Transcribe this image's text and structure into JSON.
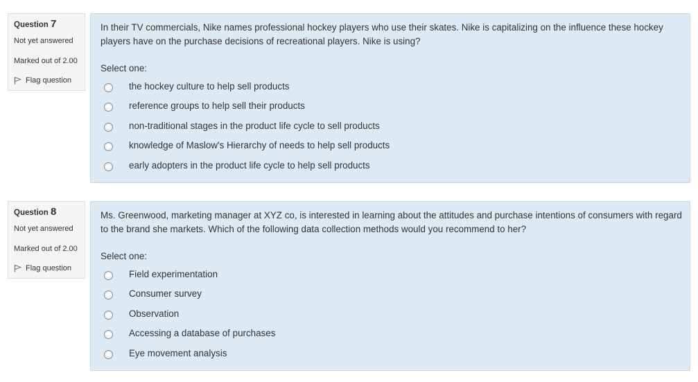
{
  "questions": [
    {
      "label": "Question",
      "number": "7",
      "state": "Not yet answered",
      "grade": "Marked out of 2.00",
      "flag_label": "Flag question",
      "text": "In their TV commercials, Nike names professional hockey players who use their skates. Nike is capitalizing on the influence these hockey players have on the purchase decisions of recreational players. Nike is using?",
      "prompt": "Select one:",
      "options": [
        "the hockey culture to help sell products",
        "reference groups to help sell their products",
        "non-traditional stages in the product life cycle to sell products",
        "knowledge of Maslow's Hierarchy of needs to help sell products",
        "early adopters in the product life cycle to help sell products"
      ]
    },
    {
      "label": "Question",
      "number": "8",
      "state": "Not yet answered",
      "grade": "Marked out of 2.00",
      "flag_label": "Flag question",
      "text": "Ms. Greenwood, marketing manager at XYZ co,  is interested in learning about the attitudes and purchase intentions of consumers with regard to the brand she markets. Which of the following data collection methods would you recommend to her?",
      "prompt": "Select one:",
      "options": [
        "Field experimentation",
        "Consumer survey",
        "Observation",
        "Accessing a database of purchases",
        "Eye movement analysis"
      ]
    }
  ],
  "icons": {
    "flag": "flag-icon",
    "radio": "radio-unchecked"
  },
  "colors": {
    "content_bg": "#dde9f3",
    "content_border": "#c4d8e8",
    "info_bg": "#f5f5f5"
  }
}
